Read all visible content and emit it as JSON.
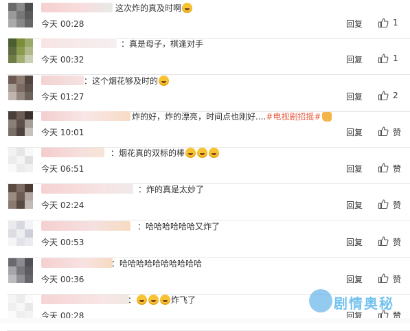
{
  "comments": [
    {
      "text_prefix": "这次炸的真及时啊",
      "time": "今天 00:28",
      "reply": "回复",
      "count": "1",
      "emojis": 1,
      "thumb_emoji": false
    },
    {
      "text_prefix": "：真是母子，棋逢对手",
      "time": "今天 00:32",
      "reply": "回复",
      "count": "1",
      "emojis": 0,
      "thumb_emoji": false
    },
    {
      "text_prefix": "：这个烟花够及时的",
      "time": "今天 01:27",
      "reply": "回复",
      "count": "2",
      "emojis": 1,
      "thumb_emoji": false
    },
    {
      "text_prefix": "炸的好，炸的漂亮，时间点也刚好....",
      "hashtag": "#电视剧招摇#",
      "time": "今天 10:01",
      "reply": "回复",
      "count": "赞",
      "emojis": 0,
      "thumb_emoji": true
    },
    {
      "text_prefix": "：烟花真的双标的棒",
      "time": "今天 06:51",
      "reply": "回复",
      "count": "赞",
      "emojis": 3,
      "thumb_emoji": false
    },
    {
      "text_prefix": "：炸的真是太妙了",
      "time": "今天 02:24",
      "reply": "回复",
      "count": "赞",
      "emojis": 0,
      "thumb_emoji": false
    },
    {
      "text_prefix": "：哈哈哈哈哈哈又炸了",
      "time": "今天 00:53",
      "reply": "回复",
      "count": "赞",
      "emojis": 0,
      "thumb_emoji": false
    },
    {
      "text_prefix": "：哈哈哈哈哈哈哈哈哈哈",
      "time": "今天 00:36",
      "reply": "回复",
      "count": "赞",
      "emojis": 0,
      "thumb_emoji": false
    },
    {
      "text_prefix": "：",
      "text_suffix": "炸飞了",
      "time": "今天 00:28",
      "reply": "回复",
      "count": "赞",
      "emojis": 3,
      "thumb_emoji": false
    }
  ],
  "watermark": {
    "text": "剧情奥秘"
  },
  "colors": {
    "hashtag": "#e8593e",
    "watermark": "#4fb3ec",
    "divider": "#e6e6e6"
  },
  "icons": {
    "like": "thumbs-up-icon",
    "emoji": "laughing-emoji-icon",
    "watermark": "flame-logo-icon"
  }
}
